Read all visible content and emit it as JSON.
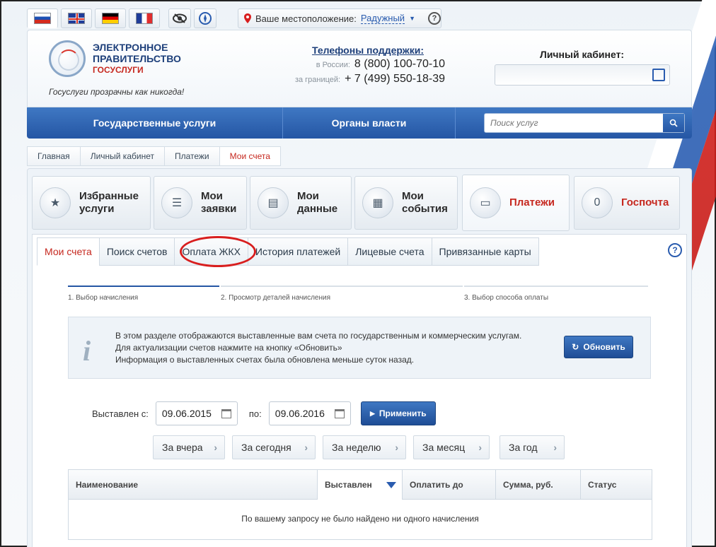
{
  "location": {
    "label": "Ваше местоположение:",
    "city": "Радужный",
    "help": "?"
  },
  "logo": {
    "line1": "ЭЛЕКТРОННОЕ",
    "line2": "ПРАВИТЕЛЬСТВО",
    "line3": "ГОСУСЛУГИ",
    "slogan": "Госуслуги прозрачны как никогда!"
  },
  "support": {
    "title": "Телефоны поддержки:",
    "russia_label": "в России:",
    "russia_phone": "8 (800) 100-70-10",
    "abroad_label": "за границей:",
    "abroad_phone": "+ 7 (499) 550-18-39"
  },
  "cabinet": {
    "title": "Личный кабинет:"
  },
  "nav": {
    "item1": "Государственные услуги",
    "item2": "Органы власти",
    "search_placeholder": "Поиск услуг"
  },
  "breadcrumbs": [
    "Главная",
    "Личный кабинет",
    "Платежи",
    "Мои счета"
  ],
  "tiles": [
    {
      "l1": "Избранные",
      "l2": "услуги"
    },
    {
      "l1": "Мои",
      "l2": "заявки"
    },
    {
      "l1": "Мои",
      "l2": "данные"
    },
    {
      "l1": "Мои",
      "l2": "события"
    },
    {
      "l1": "Платежи"
    },
    {
      "count": "0",
      "l1": "Госпочта"
    }
  ],
  "tabs": [
    "Мои счета",
    "Поиск счетов",
    "Оплата ЖКХ",
    "История платежей",
    "Лицевые счета",
    "Привязанные карты"
  ],
  "steps": [
    "1. Выбор начисления",
    "2. Просмотр деталей начисления",
    "3. Выбор способа оплаты"
  ],
  "info": {
    "line1": "В этом разделе отображаются выставленные вам счета по государственным и коммерческим услугам.",
    "line2": "Для актуализации счетов нажмите на кнопку «Обновить»",
    "line3": "Информация о выставленных счетах была обновлена меньше суток назад.",
    "refresh": "Обновить"
  },
  "filter": {
    "from_label": "Выставлен с:",
    "from": "09.06.2015",
    "to_label": "по:",
    "to": "09.06.2016",
    "apply": "Применить"
  },
  "quick": [
    "За вчера",
    "За сегодня",
    "За неделю",
    "За месяц",
    "За год"
  ],
  "table": {
    "columns": [
      "Наименование",
      "Выставлен",
      "Оплатить до",
      "Сумма, руб.",
      "Статус"
    ],
    "empty": "По вашему запросу не было найдено ни одного начисления"
  },
  "colors": {
    "accent_red": "#c6281f",
    "nav_blue": "#2556a4",
    "highlight_circle": "#d81e1e"
  }
}
